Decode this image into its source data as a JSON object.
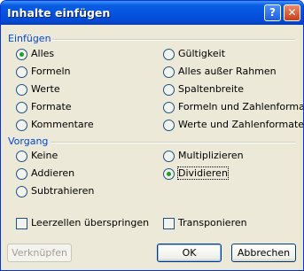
{
  "window": {
    "title": "Inhalte einfügen",
    "help_glyph": "?",
    "close_glyph": "✕"
  },
  "paste_group": {
    "title": "Einfügen",
    "left": [
      "Alles",
      "Formeln",
      "Werte",
      "Formate",
      "Kommentare"
    ],
    "right": [
      "Gültigkeit",
      "Alles außer Rahmen",
      "Spaltenbreite",
      "Formeln und Zahlenformate",
      "Werte und Zahlenformate"
    ],
    "selected": "Alles"
  },
  "operation_group": {
    "title": "Vorgang",
    "left": [
      "Keine",
      "Addieren",
      "Subtrahieren"
    ],
    "right": [
      "Multiplizieren",
      "Dividieren"
    ],
    "selected": "Dividieren"
  },
  "checkboxes": {
    "skip_blanks": "Leerzellen überspringen",
    "transpose": "Transponieren",
    "skip_blanks_checked": false,
    "transpose_checked": false
  },
  "buttons": {
    "link": "Verknüpfen",
    "ok": "OK",
    "cancel": "Abbrechen"
  },
  "colors": {
    "titlebar": "#0553e1",
    "group_title": "#0046d5",
    "dialog_bg": "#ece9d8",
    "radio_dot": "#21a121"
  }
}
